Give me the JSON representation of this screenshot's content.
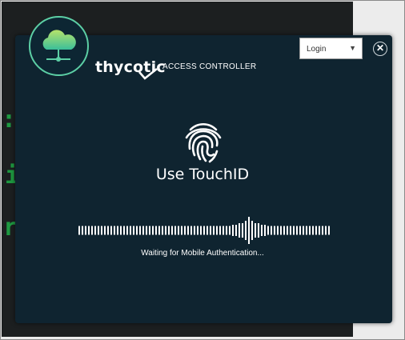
{
  "header": {
    "brand": "thycotic",
    "product": "ACCESS CONTROLLER",
    "logo_icon": "cloud-network-icon",
    "accent_color": "#5ccfa5"
  },
  "controls": {
    "login_select_value": "Login",
    "login_caret": "▼",
    "close_label": "✕"
  },
  "main": {
    "title": "Use TouchID",
    "fingerprint_icon": "fingerprint-icon",
    "status": "Waiting for Mobile Authentication..."
  },
  "colors": {
    "modal_bg": "#0f2430",
    "text": "#ffffff"
  }
}
